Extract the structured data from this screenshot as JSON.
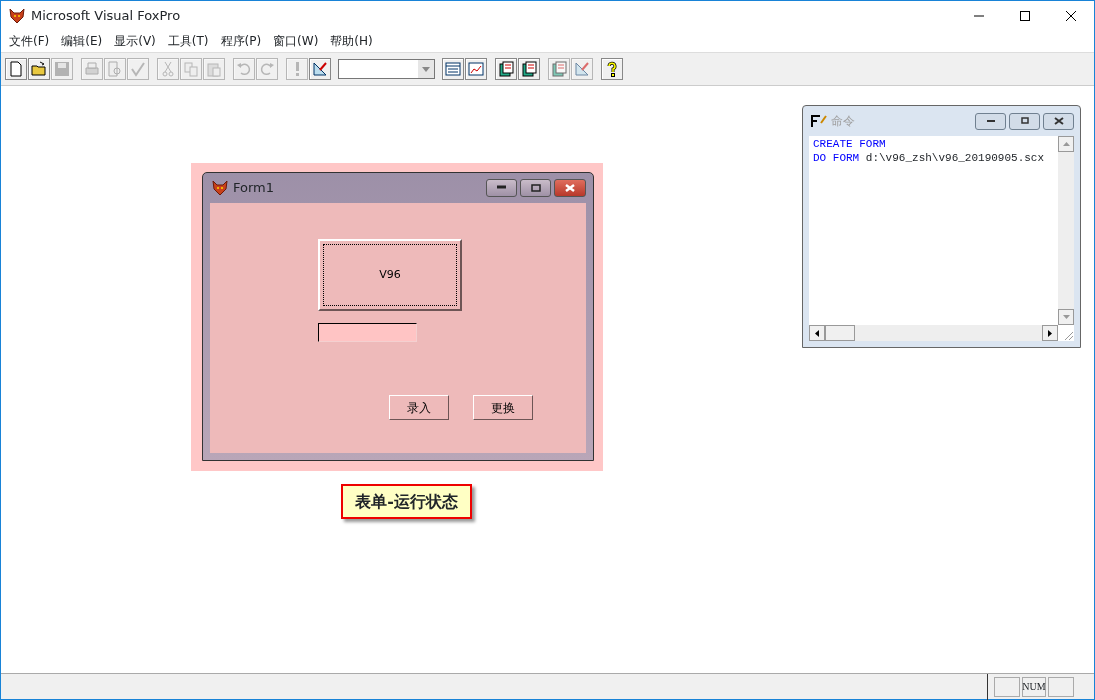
{
  "window": {
    "title": "Microsoft Visual FoxPro"
  },
  "menu": [
    "文件(F)",
    "编辑(E)",
    "显示(V)",
    "工具(T)",
    "程序(P)",
    "窗口(W)",
    "帮助(H)"
  ],
  "toolbar": [
    {
      "kind": "new",
      "disabled": false
    },
    {
      "kind": "open",
      "disabled": false
    },
    {
      "kind": "save",
      "disabled": true
    },
    {
      "kind": "sep"
    },
    {
      "kind": "print",
      "disabled": true
    },
    {
      "kind": "preview",
      "disabled": true
    },
    {
      "kind": "spell",
      "disabled": true
    },
    {
      "kind": "sep"
    },
    {
      "kind": "cut",
      "disabled": true
    },
    {
      "kind": "copy",
      "disabled": true
    },
    {
      "kind": "paste",
      "disabled": true
    },
    {
      "kind": "sep"
    },
    {
      "kind": "undo",
      "disabled": true
    },
    {
      "kind": "redo",
      "disabled": true
    },
    {
      "kind": "sep"
    },
    {
      "kind": "run",
      "disabled": true
    },
    {
      "kind": "modify",
      "disabled": false
    },
    {
      "kind": "combo"
    },
    {
      "kind": "table",
      "disabled": false
    },
    {
      "kind": "chart",
      "disabled": false
    },
    {
      "kind": "sep"
    },
    {
      "kind": "book",
      "disabled": false
    },
    {
      "kind": "book",
      "disabled": false
    },
    {
      "kind": "sep"
    },
    {
      "kind": "book",
      "disabled": true
    },
    {
      "kind": "modify",
      "disabled": true
    },
    {
      "kind": "sep"
    },
    {
      "kind": "help",
      "disabled": false
    }
  ],
  "form_window": {
    "title": "Form1",
    "controls": [
      {
        "kind": "label_button",
        "text": "V96"
      },
      {
        "kind": "textbox"
      },
      {
        "kind": "button",
        "text": "录入"
      },
      {
        "kind": "button",
        "text": "更换"
      }
    ]
  },
  "caption": "表单-运行状态",
  "command_window": {
    "title": "命令",
    "lines": [
      {
        "keyword": "CREATE FORM"
      },
      {
        "keyword": "DO FORM",
        "argument": "d:\\v96_zsh\\v96_20190905.scx"
      }
    ]
  },
  "status_bar": {
    "cells": [
      {
        "kind": "blank"
      },
      {
        "kind": "text",
        "text": "NUM"
      },
      {
        "kind": "blank"
      }
    ]
  }
}
